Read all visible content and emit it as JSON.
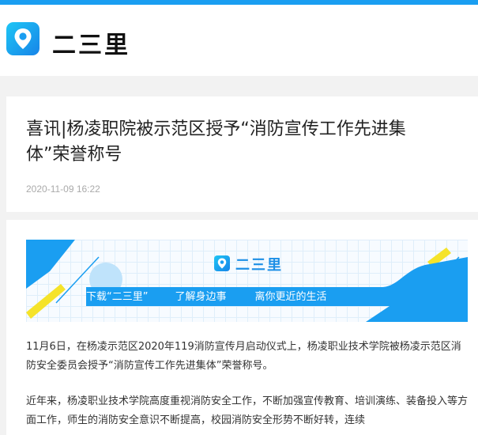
{
  "site": {
    "name": "二三里",
    "logo_icon": "location-pin-icon",
    "accent": "#1a9ef1"
  },
  "article": {
    "title": "喜讯|杨凌职院被示范区授予“消防宣传工作先进集体”荣誉称号",
    "date": "2020-11-09 16:22"
  },
  "banner": {
    "logo_text": "二三里",
    "slogans": [
      "下载“二三里”",
      "了解身边事",
      "离你更近的生活"
    ]
  },
  "body": {
    "paragraphs": [
      "11月6日，在杨凌示范区2020年119消防宣传月启动仪式上，杨凌职业技术学院被杨凌示范区消防安全委员会授予“消防宣传工作先进集体”荣誉称号。",
      "近年来，杨凌职业技术学院高度重视消防安全工作，不断加强宣传教育、培训演练、装备投入等方面工作，师生的消防安全意识不断提高，校园消防安全形势不断好转，连续"
    ]
  }
}
